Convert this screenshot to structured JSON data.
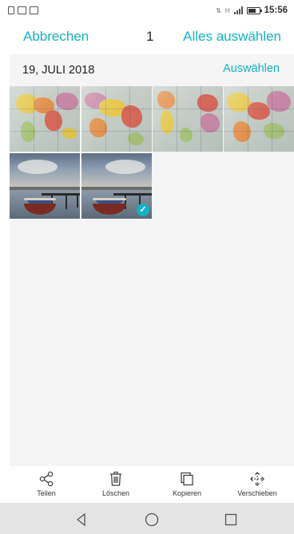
{
  "status_bar": {
    "time": "15:56",
    "left_icons": [
      "vibrate-icon",
      "mail-icon",
      "image-icon"
    ],
    "right_icons": [
      "data-icon",
      "signal-icon",
      "battery-icon"
    ],
    "network_label": "H"
  },
  "action_bar": {
    "cancel_label": "Abbrechen",
    "selected_count": "1",
    "select_all_label": "Alles auswählen"
  },
  "date_group": {
    "date_label": "19, JULI 2018",
    "select_label": "Auswählen"
  },
  "photos": [
    {
      "kind": "world-map",
      "selected": false
    },
    {
      "kind": "world-map",
      "selected": false
    },
    {
      "kind": "world-map",
      "selected": false
    },
    {
      "kind": "world-map",
      "selected": false
    },
    {
      "kind": "lake-boat",
      "selected": false
    },
    {
      "kind": "lake-boat",
      "selected": true
    }
  ],
  "bottom_actions": [
    {
      "label": "Teilen",
      "icon": "share-icon"
    },
    {
      "label": "Löschen",
      "icon": "trash-icon"
    },
    {
      "label": "Kopieren",
      "icon": "copy-icon"
    },
    {
      "label": "Verschieben",
      "icon": "move-icon"
    }
  ],
  "navigation": [
    "back-icon",
    "home-icon",
    "recents-icon"
  ],
  "colors": {
    "accent": "#12b3c3",
    "background": "#f5f5f5",
    "nav_bar": "#e4e4e4"
  }
}
